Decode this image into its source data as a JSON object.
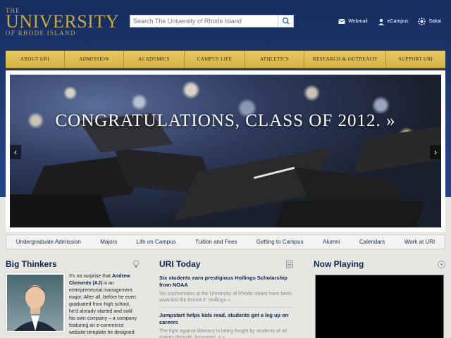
{
  "logo": {
    "line1": "THE",
    "line2": "UNIVERSITY",
    "line3": "OF RHODE ISLAND"
  },
  "search": {
    "placeholder": "Search The University of Rhode Island"
  },
  "utilities": [
    {
      "label": "Webmail",
      "icon": "mail-icon"
    },
    {
      "label": "eCampus",
      "icon": "person-icon"
    },
    {
      "label": "Sakai",
      "icon": "gear-icon"
    }
  ],
  "nav": [
    "ABOUT URI",
    "ADMISSION",
    "ACADEMICS",
    "CAMPUS LIFE",
    "ATHLETICS",
    "RESEARCH & OUTREACH",
    "SUPPORT URI"
  ],
  "hero": {
    "headline": "CONGRATULATIONS, CLASS OF 2012. »"
  },
  "subnav": [
    "Undergraduate Admission",
    "Majors",
    "Life on Campus",
    "Tuition and Fees",
    "Getting to Campus",
    "Alumni",
    "Calendars",
    "Work at URI"
  ],
  "big_thinkers": {
    "title": "Big Thinkers",
    "intro": "It's no surprise that ",
    "name": "Andrew Clemente (AJ)",
    "body": " is an entrepreneurial management major. After all, before he even graduated from high school, he'd already started and sold his own company – a company featuring an e-commerce website template he designed"
  },
  "uri_today": {
    "title": "URI Today",
    "stories": [
      {
        "title": "Six students earn prestigious Hollings Scholarship from NOAA",
        "desc": "Six sophomores at the University of Rhode Island have been awarded the Ernest F. Hollings  »"
      },
      {
        "title": "Jumpstart helps kids read, students get a leg up on careers",
        "desc": "The fight against illiteracy is being fought by students of all majors through Jumpstart, a  »"
      }
    ]
  },
  "now_playing": {
    "title": "Now Playing"
  },
  "colors": {
    "navy": "#1f3d78",
    "gold": "#d8b444",
    "logo_gold": "#c9a94a"
  }
}
